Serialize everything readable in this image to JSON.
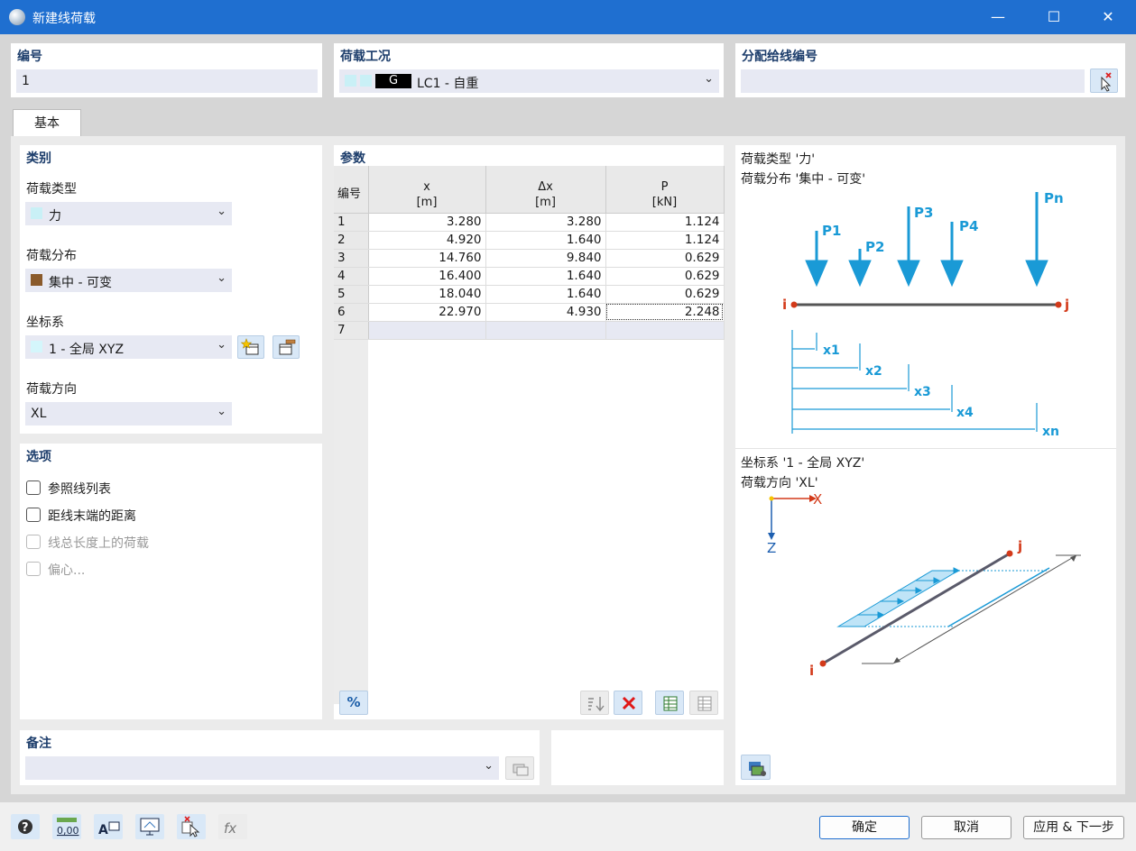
{
  "window": {
    "title": "新建线荷载",
    "minimize": "—",
    "maximize": "☐",
    "close": "✕"
  },
  "top": {
    "number": {
      "label": "编号",
      "value": "1"
    },
    "loadcase": {
      "label": "荷载工况",
      "badge": "G",
      "value": "LC1 - 自重",
      "color": "#c9f0f6"
    },
    "assign": {
      "label": "分配给线编号",
      "value": ""
    }
  },
  "tabs": [
    {
      "label": "基本"
    }
  ],
  "category": {
    "title": "类别",
    "load_type": {
      "label": "荷载类型",
      "value": "力",
      "swatch": "#c9f0f6"
    },
    "load_distribution": {
      "label": "荷载分布",
      "value": "集中 - 可变",
      "swatch": "#8a5a2b"
    },
    "coord_system": {
      "label": "坐标系",
      "value": "1 - 全局 XYZ",
      "swatch": "#d4f6fb"
    },
    "load_direction": {
      "label": "荷载方向",
      "value": "XL"
    }
  },
  "options": {
    "title": "选项",
    "items": [
      {
        "label": "参照线列表",
        "enabled": true,
        "checked": false
      },
      {
        "label": "距线末端的距离",
        "enabled": true,
        "checked": false
      },
      {
        "label": "线总长度上的荷载",
        "enabled": false,
        "checked": false
      },
      {
        "label": "偏心...",
        "enabled": false,
        "checked": false
      }
    ]
  },
  "params": {
    "title": "参数",
    "columns": [
      {
        "name": "编号",
        "unit": ""
      },
      {
        "name": "x",
        "unit": "[m]"
      },
      {
        "name": "Δx",
        "unit": "[m]"
      },
      {
        "name": "P",
        "unit": "[kN]"
      }
    ],
    "rows": [
      {
        "n": "1",
        "x": "3.280",
        "dx": "3.280",
        "p": "1.124"
      },
      {
        "n": "2",
        "x": "4.920",
        "dx": "1.640",
        "p": "1.124"
      },
      {
        "n": "3",
        "x": "14.760",
        "dx": "9.840",
        "p": "0.629"
      },
      {
        "n": "4",
        "x": "16.400",
        "dx": "1.640",
        "p": "0.629"
      },
      {
        "n": "5",
        "x": "18.040",
        "dx": "1.640",
        "p": "0.629"
      },
      {
        "n": "6",
        "x": "22.970",
        "dx": "4.930",
        "p": "2.248"
      },
      {
        "n": "7",
        "x": "",
        "dx": "",
        "p": ""
      }
    ],
    "percent_button": "%"
  },
  "preview": {
    "load_type_text": "荷载类型 '力'",
    "load_dist_text": "荷载分布 '集中 - 可变'",
    "coord_text": "坐标系 '1 - 全局 XYZ'",
    "direction_text": "荷载方向 'XL'",
    "diagram": {
      "forces": [
        "P1",
        "P2",
        "P3",
        "P4",
        "Pn"
      ],
      "dims": [
        "x1",
        "x2",
        "x3",
        "x4",
        "xn"
      ],
      "node_i": "i",
      "node_j": "j",
      "axis_x": "X",
      "axis_z": "Z",
      "arrow_color": "#1a9ad6",
      "node_color": "#d33a1a"
    }
  },
  "remarks": {
    "label": "备注",
    "value": ""
  },
  "footer": {
    "ok": "确定",
    "cancel": "取消",
    "apply_next": "应用 & 下一步"
  }
}
